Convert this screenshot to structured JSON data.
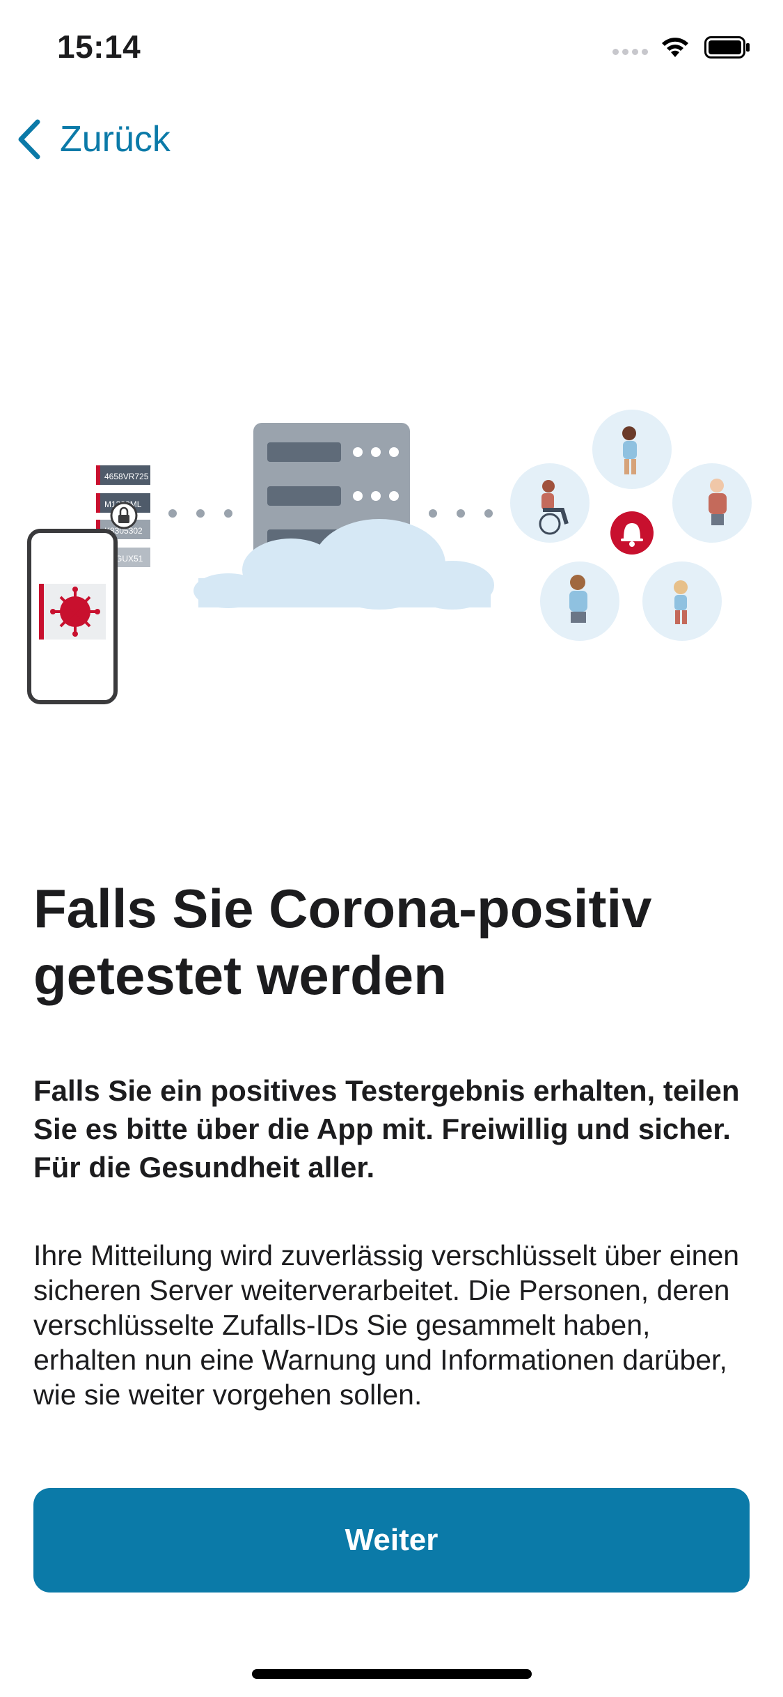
{
  "status_bar": {
    "time": "15:14"
  },
  "nav": {
    "back_label": "Zurück"
  },
  "illustration": {
    "ids": [
      "4658VR725",
      "M1389ML",
      "K8305302",
      "G5GUX51"
    ]
  },
  "content": {
    "title": "Falls Sie Corona-positiv getestet werden",
    "subtitle": "Falls Sie ein positives Testergebnis erhalten, teilen Sie es bitte über die App mit. Freiwillig und sicher. Für die Gesundheit aller.",
    "body": "Ihre Mitteilung wird zuverlässig verschlüsselt über einen sicheren Server weiterverarbeitet. Die Personen, deren verschlüsselte Zufalls-IDs Sie gesammelt haben, erhalten nun eine Warnung und Informationen darüber, wie sie weiter vorgehen sollen."
  },
  "actions": {
    "continue_label": "Weiter"
  },
  "colors": {
    "accent": "#0b7aa8",
    "alert": "#c8102e"
  }
}
